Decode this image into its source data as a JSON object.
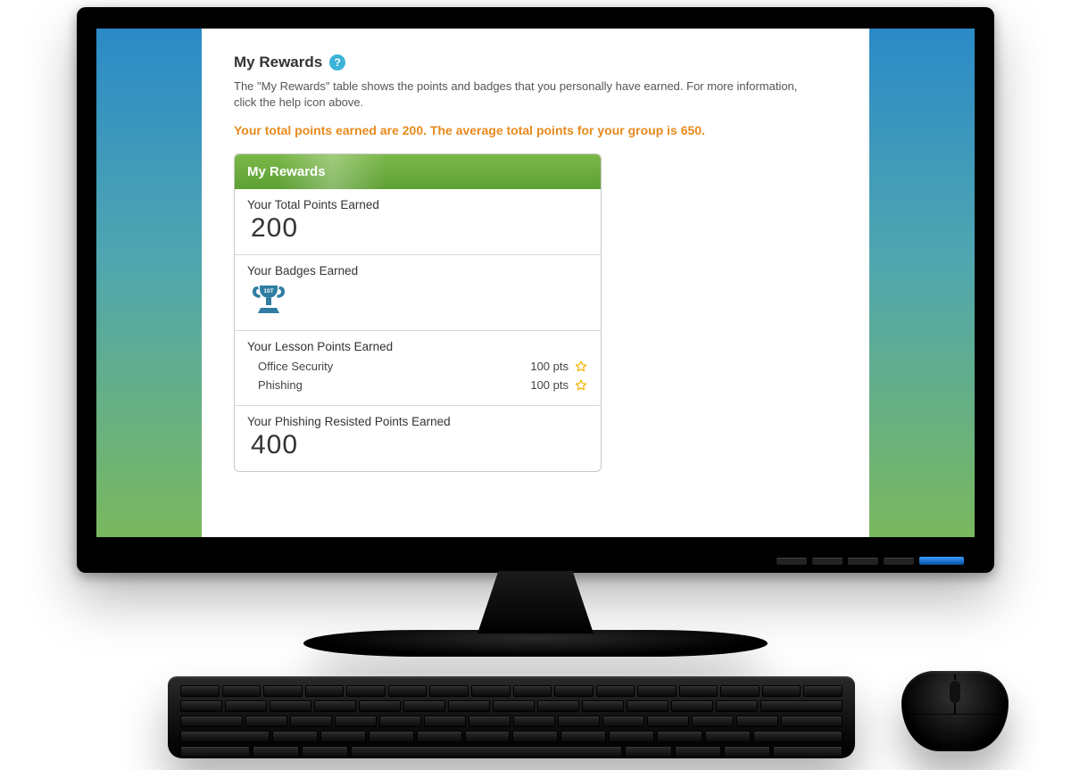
{
  "page": {
    "title": "My Rewards",
    "help_icon_glyph": "?",
    "description": "The \"My Rewards\" table shows the points and badges that you personally have earned. For more information, click the help icon above.",
    "summary_line": "Your total points earned are 200. The average total points for your group is 650."
  },
  "card": {
    "header": "My Rewards",
    "total_points": {
      "label": "Your Total Points Earned",
      "value": "200"
    },
    "badges": {
      "label": "Your Badges Earned",
      "badge_icon": "trophy-1st",
      "badge_text": "1ST"
    },
    "lessons": {
      "label": "Your Lesson Points Earned",
      "rows": [
        {
          "name": "Office Security",
          "points": "100 pts",
          "starred": true
        },
        {
          "name": "Phishing",
          "points": "100 pts",
          "starred": true
        }
      ]
    },
    "phishing_resisted": {
      "label": "Your Phishing Resisted Points Earned",
      "value": "400"
    }
  },
  "colors": {
    "accent_orange": "#e78a1d",
    "header_green": "#5ea035",
    "help_blue": "#3bb4d8",
    "trophy_blue": "#2f7da3",
    "star_gold": "#f2b200"
  }
}
